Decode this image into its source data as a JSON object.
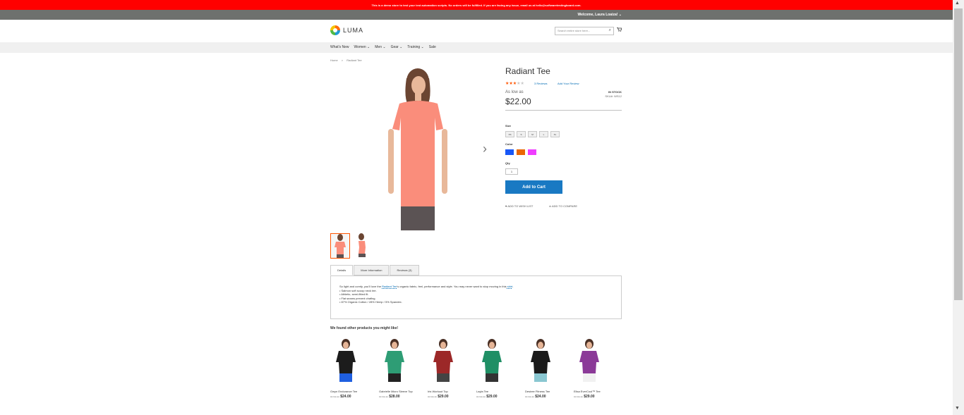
{
  "banner": {
    "text": "This is a demo store to test your test automation scripts. No orders will be fulfilled. If you are facing any issue, email us at hello@softwaretestingboard.com."
  },
  "panel": {
    "welcome": "Welcome, Laura Loaiza! ⌄"
  },
  "header": {
    "logo_text": "LUMA",
    "search_placeholder": "Search entire store here...",
    "search_icon": "search-icon",
    "cart_icon": "cart-icon"
  },
  "nav": {
    "items": [
      "What's New",
      "Women ⌄",
      "Men ⌄",
      "Gear ⌄",
      "Training ⌄",
      "Sale"
    ]
  },
  "breadcrumb": {
    "home": "Home",
    "sep": ">",
    "current": "Radiant Tee"
  },
  "product": {
    "title": "Radiant Tee",
    "rating_filled": "★★★",
    "rating_empty": "★★",
    "rating_fraction": 0.6,
    "reviews": "3 Reviews",
    "add_review": "Add Your Review",
    "as_low_as": "As low as",
    "price": "$22.00",
    "stock": "IN STOCK",
    "sku": "SKU#: WS12"
  },
  "options": {
    "size_label": "Size",
    "sizes": [
      "XS",
      "S",
      "M",
      "L",
      "XL"
    ],
    "color_label": "Color",
    "colors": [
      "#1857f7",
      "#eb6703",
      "#ef3dff"
    ],
    "qty_label": "Qty",
    "qty_value": "1"
  },
  "actions": {
    "add_to_cart": "Add to Cart",
    "wishlist": "♥ ADD TO WISH LIST",
    "compare": "ılı ADD TO COMPARE"
  },
  "gallery": {
    "next_arrow": "›",
    "main_color": "#fa8d7b"
  },
  "tabs": [
    {
      "label": "Details"
    },
    {
      "label": "More Information"
    },
    {
      "label": "Reviews (3)"
    }
  ],
  "details": {
    "intro_a": "So light and comfy, you'll love the",
    "intro_link": "Radiant Tee",
    "intro_b": "'s organic fabric, feel, performance and style. You may never want to stop moving in this",
    "intro_link2": "shirt",
    "intro_end": ".",
    "bullets": [
      "• Salmon soft scoop neck tee.",
      "• Athletic, semi-fitted fit.",
      "• Flat seams prevent chafing.",
      "• 87% Organic Cotton / 28% Hemp / 5% Spandex."
    ]
  },
  "related": {
    "title": "We found other products you might like!",
    "as_low_as": "As low as",
    "items": [
      {
        "name": "Gwyn Endurance Tee",
        "price": "$24.00",
        "shirt": "#1c1c1c",
        "bottom": "#1f5fe0"
      },
      {
        "name": "Gabrielle Micro Sleeve Top",
        "price": "$28.00",
        "shirt": "#2e9d75",
        "bottom": "#222222"
      },
      {
        "name": "Iris Workout Top",
        "price": "$29.00",
        "shirt": "#9c2828",
        "bottom": "#444444"
      },
      {
        "name": "Layla Tee",
        "price": "$29.00",
        "shirt": "#1f8f65",
        "bottom": "#333333"
      },
      {
        "name": "Desiree Fitness Tee",
        "price": "$24.00",
        "shirt": "#1a1a1a",
        "bottom": "#8ac7d1"
      },
      {
        "name": "Elisa EverCool™ Tee",
        "price": "$29.00",
        "shirt": "#8b3a98",
        "bottom": "#f1f1f1"
      }
    ]
  },
  "scrollbar": {
    "up": "▲",
    "down": "▼"
  }
}
